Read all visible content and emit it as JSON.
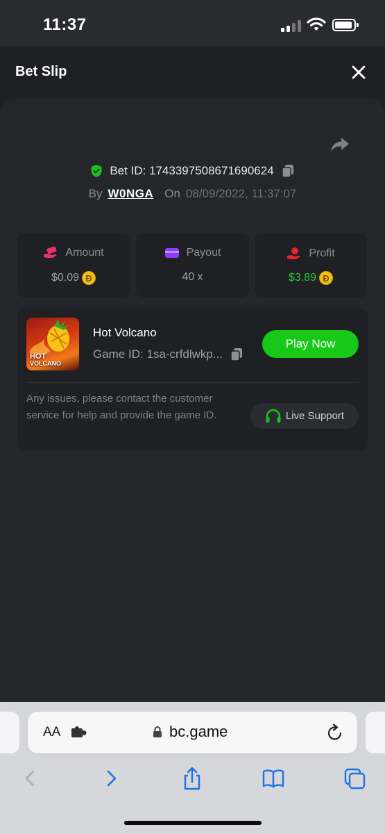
{
  "status_bar": {
    "time": "11:37"
  },
  "header": {
    "title": "Bet Slip"
  },
  "bet": {
    "id_label": "Bet ID: 1743397508671690624",
    "by_label": "By",
    "user": "W0NGA",
    "on_label": "On",
    "date": "08/09/2022, 11:37:07"
  },
  "stats": [
    {
      "label": "Amount",
      "value": "$0.09",
      "icon": "money-hand-icon",
      "color": "#e8336a",
      "value_color": "#9aa0a6"
    },
    {
      "label": "Payout",
      "value": "40 x",
      "icon": "wallet-icon",
      "color": "#8b3cf5",
      "value_color": "#8c8f96"
    },
    {
      "label": "Profit",
      "value": "$3.89",
      "icon": "coin-hand-icon",
      "color": "#e8252b",
      "value_color": "#26c93a"
    }
  ],
  "coin": {
    "symbol": "Ð",
    "color": "#f2c019"
  },
  "game": {
    "thumb_text_1": "HOT",
    "thumb_text_2": "VOLCANO",
    "name": "Hot Volcano",
    "id_label": "Game ID: 1sa-crfdlwkp...",
    "play_label": "Play Now",
    "support_note": "Any issues, please contact the customer service for help and provide the game ID.",
    "support_label": "Live Support"
  },
  "browser": {
    "aa_label": "AA",
    "url": "bc.game"
  },
  "colors": {
    "accent_green": "#17c817",
    "background": "#1e1f22",
    "panel": "#24262b",
    "card": "#1f2024"
  }
}
